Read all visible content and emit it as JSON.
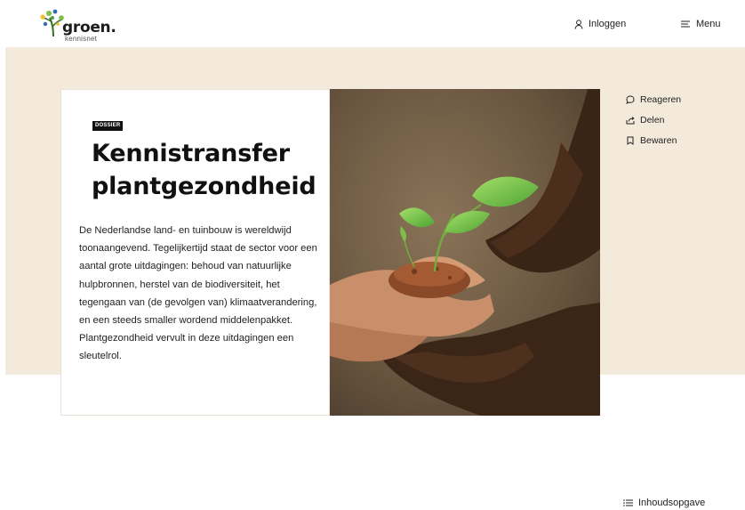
{
  "header": {
    "logo_word": "groen",
    "logo_sub": "kennisnet",
    "login_label": "Inloggen",
    "menu_label": "Menu"
  },
  "hero": {
    "badge": "DOSSIER",
    "title": "Kennistransfer plantgezondheid",
    "intro": "De Nederlandse land- en tuinbouw is wereldwijd toonaangevend. Tegelijkertijd staat de sector voor een aantal grote uitdagingen: behoud van natuurlijke hulpbronnen, herstel van de biodiversiteit, het tegengaan van (de gevolgen van) klimaatverandering, en een steeds smaller wordend middelenpakket. Plantgezondheid vervult in deze uitdagingen een sleutelrol."
  },
  "actions": [
    {
      "label": "Reageren",
      "icon": "chat-bubble-icon"
    },
    {
      "label": "Delen",
      "icon": "share-icon"
    },
    {
      "label": "Bewaren",
      "icon": "bookmark-icon"
    }
  ],
  "toc": {
    "label": "Inhoudsopgave",
    "icon": "list-icon"
  },
  "colors": {
    "band": "#f3eadc",
    "text": "#111111",
    "leaf": "#7cc04a"
  }
}
